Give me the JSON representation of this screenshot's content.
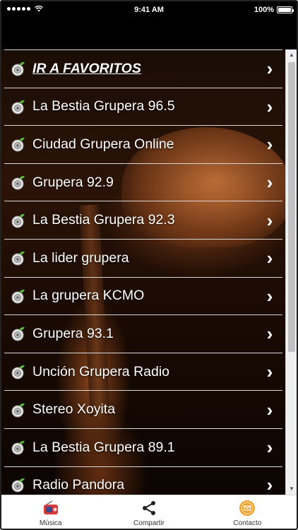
{
  "status_bar": {
    "time": "9:41 AM",
    "battery": "100%",
    "battery_level": 1.0
  },
  "list": {
    "items": [
      {
        "label": "IR A FAVORITOS",
        "favorite": true
      },
      {
        "label": "La Bestia Grupera 96.5"
      },
      {
        "label": "Ciudad Grupera Online"
      },
      {
        "label": "Grupera 92.9"
      },
      {
        "label": "La Bestia Grupera 92.3"
      },
      {
        "label": "La lider grupera"
      },
      {
        "label": "La grupera KCMO"
      },
      {
        "label": "Grupera 93.1"
      },
      {
        "label": "Unción Grupera Radio"
      },
      {
        "label": "Stereo Xoyita"
      },
      {
        "label": "La Bestia Grupera 89.1"
      },
      {
        "label": "Radio Pandora"
      }
    ],
    "item_icon": "radio-speaker-icon",
    "chevron_icon": "chevron-right-icon"
  },
  "tabbar": {
    "tabs": [
      {
        "label": "Música",
        "icon": "radio-icon"
      },
      {
        "label": "Compartir",
        "icon": "share-icon"
      },
      {
        "label": "Contacto",
        "icon": "contact-icon"
      }
    ]
  },
  "colors": {
    "accent_green": "#5bbf3a",
    "row_border": "#d8d8d8",
    "contact_orange": "#f0a030",
    "music_red": "#d93a3a"
  }
}
